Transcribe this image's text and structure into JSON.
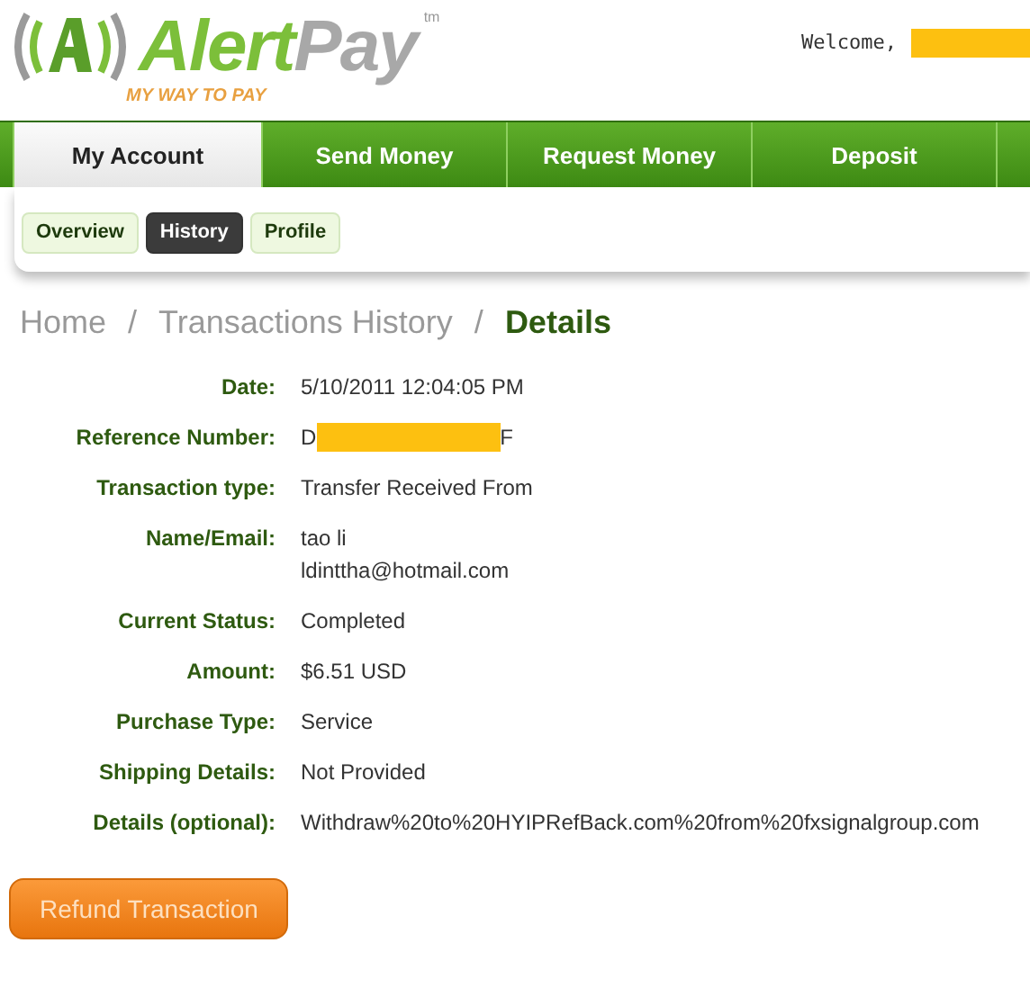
{
  "header": {
    "brand_first": "Alert",
    "brand_second": "Pay",
    "trademark": "tm",
    "tagline": "MY WAY TO PAY",
    "welcome": "Welcome,",
    "welcome_name_redacted": true
  },
  "main_tabs": [
    {
      "label": "My Account",
      "selected": true
    },
    {
      "label": "Send Money",
      "selected": false
    },
    {
      "label": "Request Money",
      "selected": false
    },
    {
      "label": "Deposit",
      "selected": false
    }
  ],
  "sub_tabs": [
    {
      "label": "Overview",
      "selected": false
    },
    {
      "label": "History",
      "selected": true
    },
    {
      "label": "Profile",
      "selected": false
    }
  ],
  "breadcrumb": [
    {
      "label": "Home",
      "current": false
    },
    {
      "label": "Transactions History",
      "current": false
    },
    {
      "label": "Details",
      "current": true
    }
  ],
  "breadcrumb_separator": "/",
  "details": [
    {
      "label": "Date:",
      "values": [
        "5/10/2011 12:04:05 PM"
      ]
    },
    {
      "label": "Reference Number:",
      "kind": "redacted",
      "prefix": "D",
      "suffix": "F"
    },
    {
      "label": "Transaction type:",
      "values": [
        "Transfer Received From"
      ]
    },
    {
      "label": "Name/Email:",
      "values": [
        "tao li",
        "ldinttha@hotmail.com"
      ]
    },
    {
      "label": "Current Status:",
      "values": [
        "Completed"
      ]
    },
    {
      "label": "Amount:",
      "values": [
        "$6.51 USD"
      ]
    },
    {
      "label": "Purchase Type:",
      "values": [
        "Service"
      ]
    },
    {
      "label": "Shipping Details:",
      "values": [
        "Not Provided"
      ]
    },
    {
      "label": "Details (optional):",
      "values": [
        "Withdraw%20to%20HYIPRefBack.com%20from%20fxsignalgroup.com"
      ]
    }
  ],
  "refund_button": "Refund Transaction"
}
